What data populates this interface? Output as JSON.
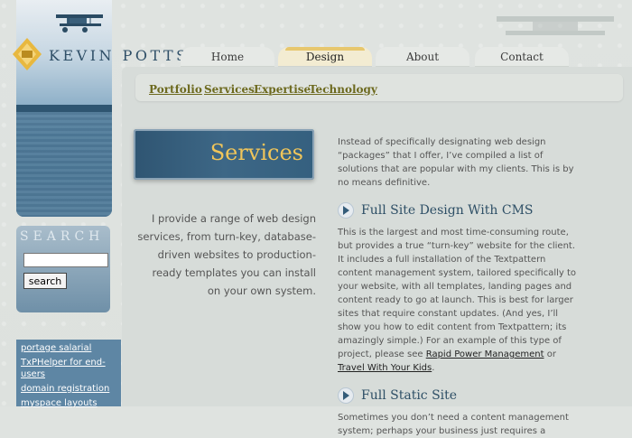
{
  "header": {
    "title": "KEVIN POTTS"
  },
  "nav": {
    "tabs": [
      {
        "label": "Home"
      },
      {
        "label": "Design"
      },
      {
        "label": "About"
      },
      {
        "label": "Contact"
      }
    ],
    "active_index": 1
  },
  "subnav": {
    "items": [
      "Portfolio",
      "Services",
      "Expertise",
      "Technology"
    ]
  },
  "banner": {
    "title": "Services"
  },
  "intro": {
    "left_text": "I provide a range of web design services, from turn-key, database-driven websites to production-ready templates you can install on your own system."
  },
  "right": {
    "intro_paragraph": "Instead of specifically designating web design “packages” that I offer, I’ve compiled a list of solutions that are popular with my clients. This is by no means definitive.",
    "sections": [
      {
        "heading": "Full Site Design With CMS",
        "body_start": "This is the largest and most time-consuming route, but provides a true “turn-key” website for the client. It includes a full installation of the Textpattern content management system, tailored specifically to your website, with all templates, landing pages and content ready to go at launch. This is best for larger sites that require constant updates. (And yes, I’ll show you how to edit content from Textpattern; its amazingly simple.) For an example of this type of project, please see ",
        "link1": "Rapid Power Management",
        "middle": " or ",
        "link2": "Travel With Your Kids",
        "end": "."
      },
      {
        "heading": "Full Static Site",
        "body": "Sometimes you don’t need a content management system; perhaps your business just requires a"
      }
    ]
  },
  "search": {
    "label": "SEARCH",
    "button": "search",
    "value": ""
  },
  "sponsored_links": [
    "portage salarial",
    "TxPHelper for end-users",
    "domain registration",
    "myspace layouts"
  ],
  "colors": {
    "accent_gold": "#f0c55a",
    "link_olive": "#6d6a1f",
    "header_blue": "#2f4f67"
  }
}
